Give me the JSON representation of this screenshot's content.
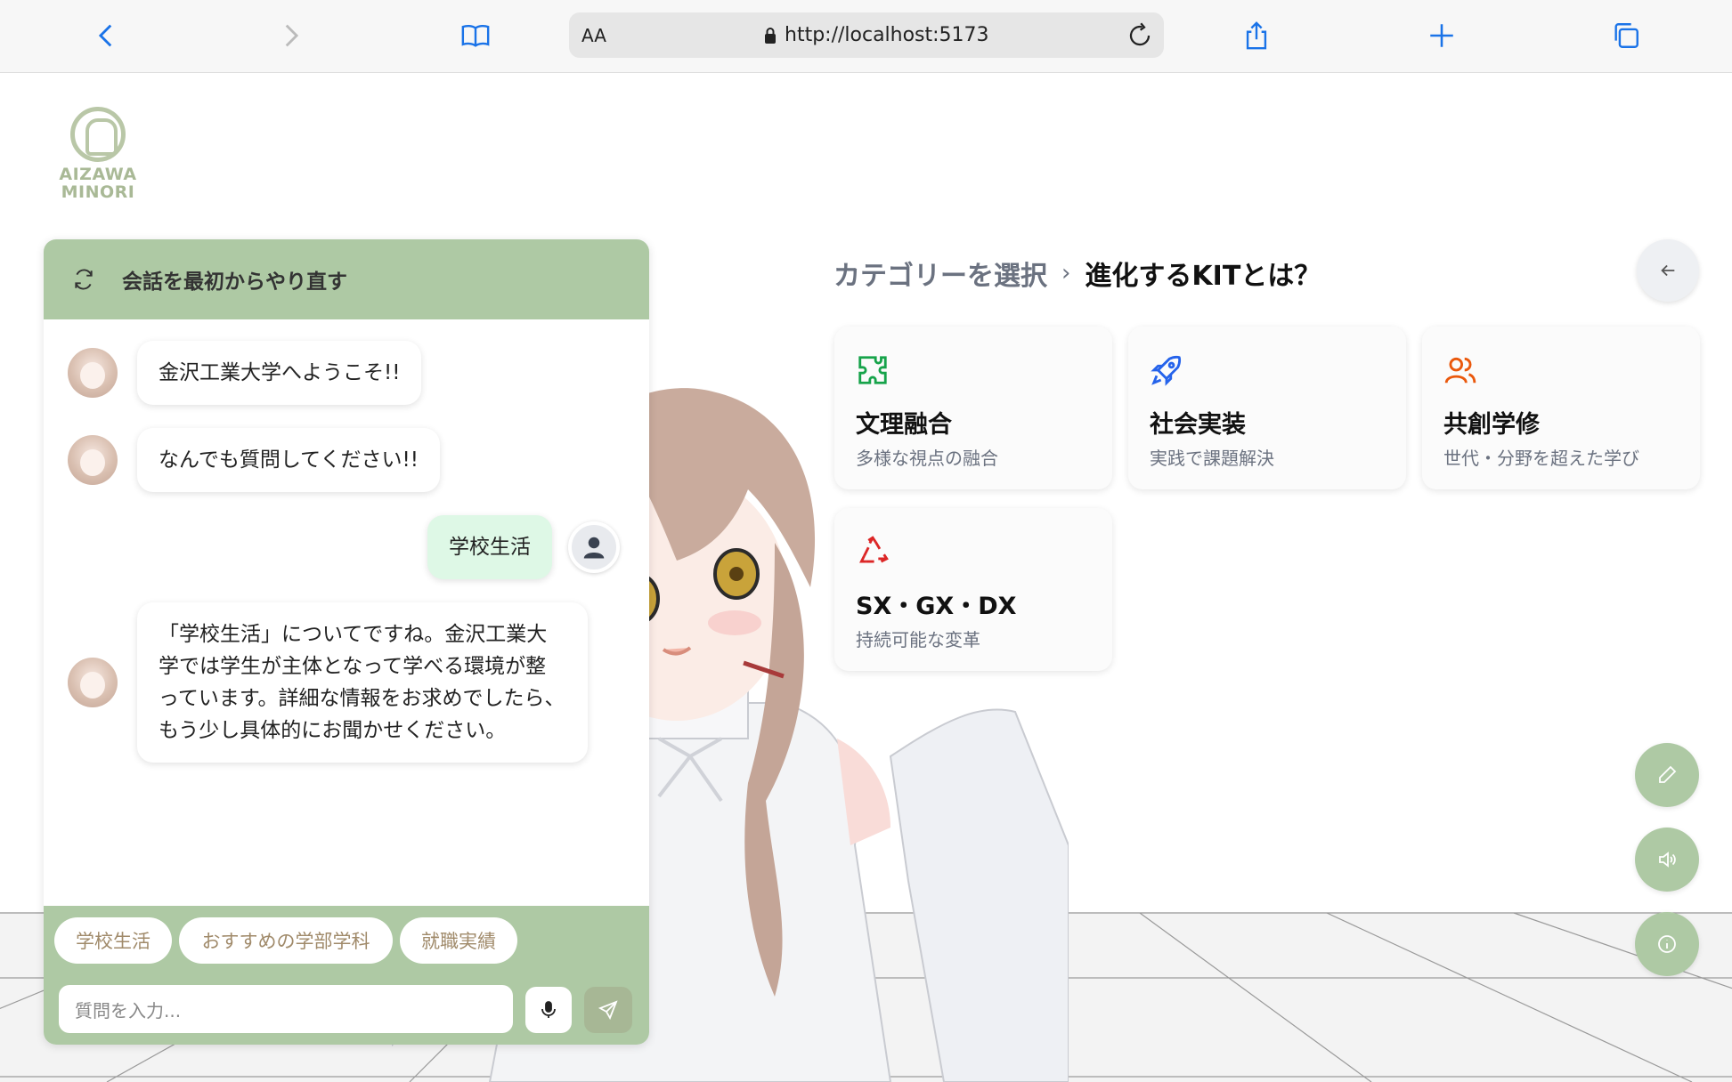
{
  "browser": {
    "text_size_label": "AA",
    "url": "http://localhost:5173"
  },
  "logo": {
    "line1": "AIZAWA",
    "line2": "MINORI"
  },
  "chat": {
    "restart_label": "会話を最初からやり直す",
    "messages": [
      {
        "role": "bot",
        "text": "金沢工業大学へようこそ!!"
      },
      {
        "role": "bot",
        "text": "なんでも質問してください!!"
      },
      {
        "role": "user",
        "text": "学校生活"
      },
      {
        "role": "bot",
        "text": "「学校生活」についてですね。金沢工業大学では学生が主体となって学べる環境が整っています。詳細な情報をお求めでしたら、もう少し具体的にお聞かせください。"
      }
    ],
    "suggestions": [
      "学校生活",
      "おすすめの学部学科",
      "就職実績"
    ],
    "input_placeholder": "質問を入力..."
  },
  "breadcrumb": {
    "parent": "カテゴリーを選択",
    "current": "進化するKITとは？"
  },
  "categories": [
    {
      "title": "文理融合",
      "subtitle": "多様な視点の融合",
      "icon": "puzzle-icon",
      "color": "#16a34a"
    },
    {
      "title": "社会実装",
      "subtitle": "実践で課題解決",
      "icon": "rocket-icon",
      "color": "#2563eb"
    },
    {
      "title": "共創学修",
      "subtitle": "世代・分野を超えた学び",
      "icon": "users-icon",
      "color": "#ea580c"
    },
    {
      "title": "SX・GX・DX",
      "subtitle": "持続可能な変革",
      "icon": "recycle-icon",
      "color": "#dc2626"
    }
  ],
  "colors": {
    "accent_green": "#aec9a4",
    "user_bubble": "#def8e6",
    "chip_text": "#a08a6a"
  }
}
